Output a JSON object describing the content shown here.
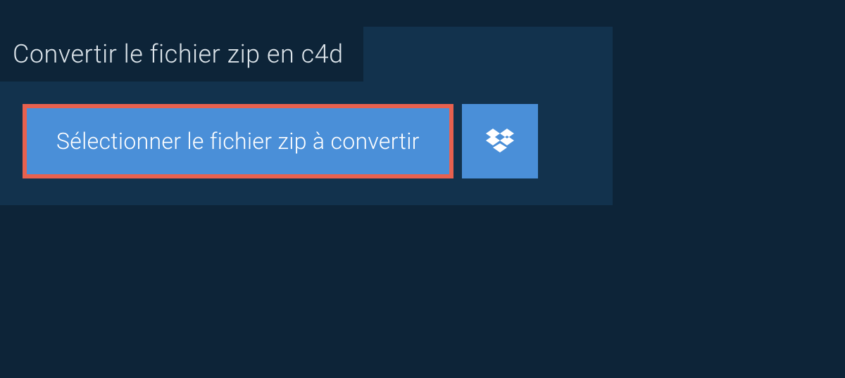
{
  "title": "Convertir le fichier zip en c4d",
  "selectButton": {
    "label": "Sélectionner le fichier zip à convertir"
  },
  "colors": {
    "background": "#0d2438",
    "panel": "#12324d",
    "button": "#4a8fd8",
    "highlight": "#e8614f",
    "text": "#dce4ea",
    "buttonText": "#ffffff"
  }
}
